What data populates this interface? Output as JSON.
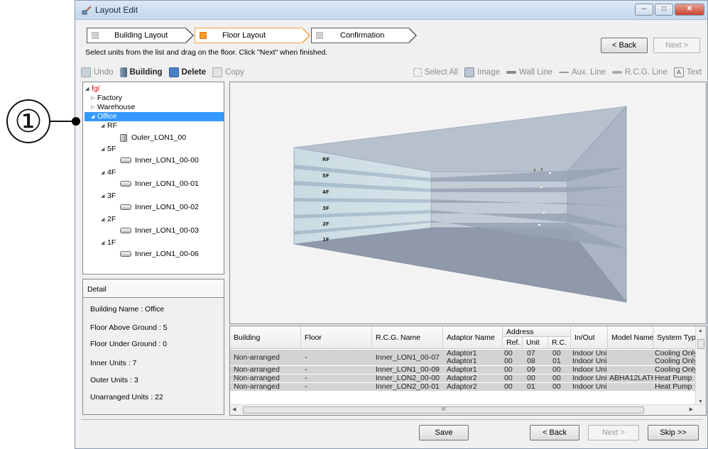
{
  "callout": {
    "label": "①"
  },
  "window": {
    "title": "Layout Edit",
    "controls": {
      "minimize": "–",
      "maximize": "□",
      "close": "✕"
    }
  },
  "steps": [
    {
      "label": "Building Layout",
      "active": false
    },
    {
      "label": "Floor Layout",
      "active": true
    },
    {
      "label": "Confirmation",
      "active": false
    }
  ],
  "instruction": "Select units from the list and drag on the floor. Click \"Next\" when finished.",
  "nav": {
    "back": "< Back",
    "next": "Next >"
  },
  "toolbar": {
    "undo": "Undo",
    "building": "Building",
    "delete": "Delete",
    "copy": "Copy",
    "select_all": "Select All",
    "image": "Image",
    "wall_line": "Wall Line",
    "aux_line": "Aux. Line",
    "rcg_line": "R.C.G. Line",
    "text": "Text"
  },
  "tree": {
    "root": "fgl",
    "nodes": [
      {
        "label": "Factory",
        "expander": "▷"
      },
      {
        "label": "Warehouse",
        "expander": "▷"
      },
      {
        "label": "Office",
        "expander": "◢",
        "selected": true
      },
      {
        "label": "RF",
        "expander": "◢"
      },
      {
        "label": "Outer_LON1_00",
        "icon": "outdoor-unit-icon"
      },
      {
        "label": "5F",
        "expander": "◢"
      },
      {
        "label": "Inner_LON1_00-00",
        "icon": "indoor-unit-icon"
      },
      {
        "label": "4F",
        "expander": "◢"
      },
      {
        "label": "Inner_LON1_00-01",
        "icon": "indoor-unit-icon"
      },
      {
        "label": "3F",
        "expander": "◢"
      },
      {
        "label": "Inner_LON1_00-02",
        "icon": "indoor-unit-icon"
      },
      {
        "label": "2F",
        "expander": "◢"
      },
      {
        "label": "Inner_LON1_00-03",
        "icon": "indoor-unit-icon"
      },
      {
        "label": "1F",
        "expander": "◢"
      },
      {
        "label": "Inner_LON1_00-06",
        "icon": "indoor-unit-icon"
      }
    ]
  },
  "detail": {
    "title": "Detail",
    "rows": [
      "Building Name : Office",
      "Floor Above Ground : 5",
      "Floor Under Ground : 0",
      "Inner Units : 7",
      "Outer Units : 3",
      "Unarranged Units : 22"
    ]
  },
  "view3d": {
    "floor_labels": [
      "RF",
      "5F",
      "4F",
      "3F",
      "2F",
      "1F"
    ]
  },
  "grid": {
    "headers": {
      "building": "Building",
      "floor": "Floor",
      "rcg_name": "R.C.G. Name",
      "adaptor_name": "Adaptor Name",
      "address": "Address",
      "ref": "Ref.",
      "unit": "Unit",
      "rc": "R.C.",
      "in_out": "In/Out",
      "model_name": "Model Name",
      "system_type": "System Type"
    },
    "merged_row": {
      "building": "Non-arranged",
      "floor": "-",
      "rcg_name": "Inner_LON1_00-07"
    },
    "rows": [
      {
        "adaptor": "Adaptor1",
        "ref": "00",
        "unit": "07",
        "rc": "00",
        "inout": "Indoor Uni",
        "model": "",
        "system": "Cooling Only"
      },
      {
        "adaptor": "Adaptor1",
        "ref": "00",
        "unit": "08",
        "rc": "01",
        "inout": "Indoor Uni",
        "model": "",
        "system": "Cooling Only"
      },
      {
        "building": "Non-arranged",
        "floor": "-",
        "rcg": "Inner_LON1_00-09",
        "adaptor": "Adaptor1",
        "ref": "00",
        "unit": "09",
        "rc": "00",
        "inout": "Indoor Uni",
        "model": "",
        "system": "Cooling Only"
      },
      {
        "building": "Non-arranged",
        "floor": "-",
        "rcg": "Inner_LON2_00-00",
        "adaptor": "Adaptor2",
        "ref": "00",
        "unit": "00",
        "rc": "00",
        "inout": "Indoor Uni",
        "model": "ABHA12LATH",
        "system": "Heat Pump"
      },
      {
        "building": "Non-arranged",
        "floor": "-",
        "rcg": "Inner_LON2_00-01",
        "adaptor": "Adaptor2",
        "ref": "00",
        "unit": "01",
        "rc": "00",
        "inout": "Indoor Uni",
        "model": "",
        "system": "Heat Pump"
      }
    ],
    "scroll_mark": "III"
  },
  "footer": {
    "save": "Save",
    "back": "< Back",
    "next": "Next >",
    "skip": "Skip >>"
  }
}
